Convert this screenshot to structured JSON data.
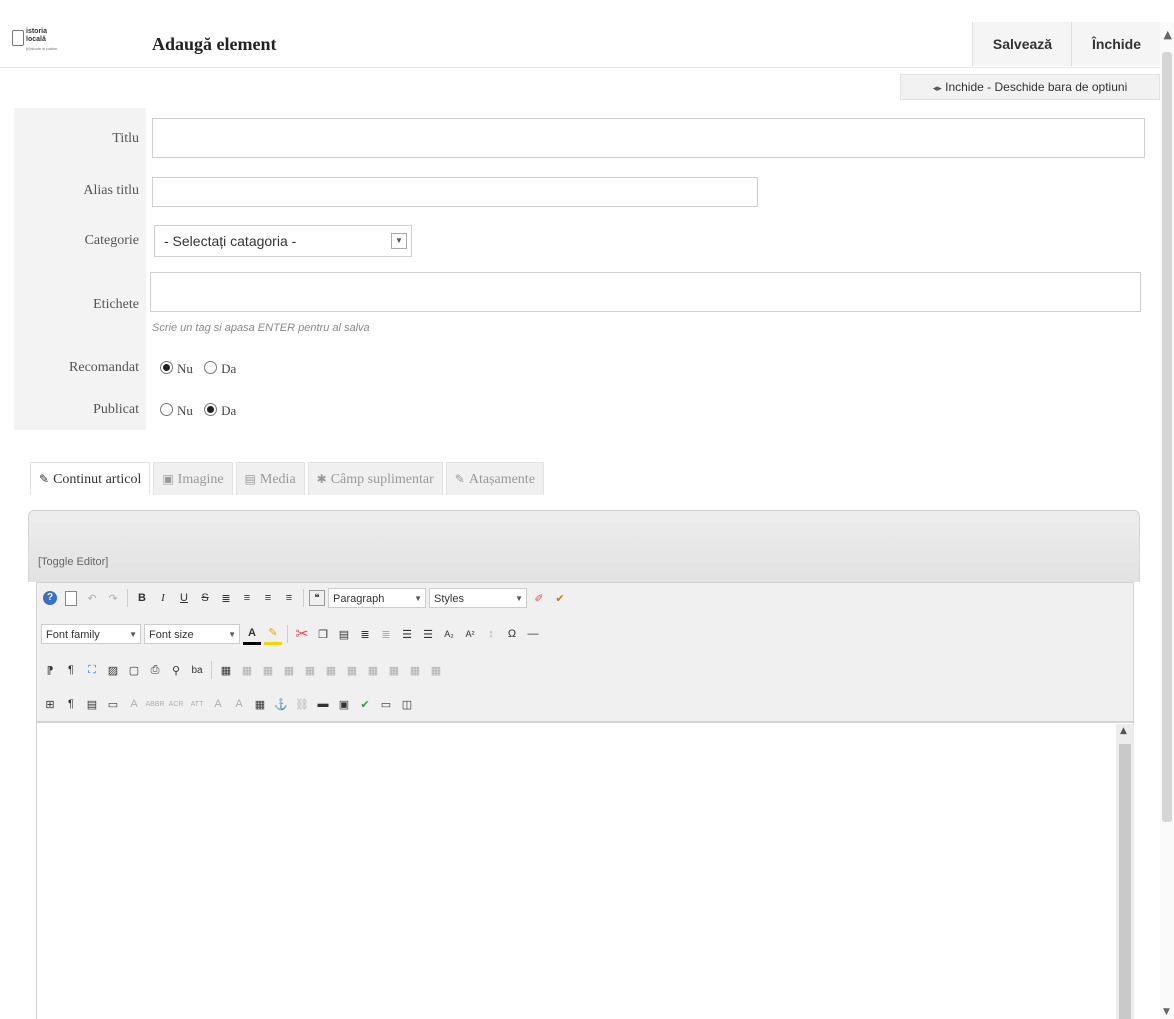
{
  "header": {
    "logo_line1": "istoria",
    "logo_line2": "locală",
    "logo_line3": "(il)istorie și patrim",
    "title": "Adaugă element",
    "save_label": "Salvează",
    "close_label": "Închide"
  },
  "options_toggle": "Inchide - Deschide bara de optiuni",
  "form": {
    "title_label": "Titlu",
    "title_value": "",
    "alias_label": "Alias titlu",
    "alias_value": "",
    "category_label": "Categorie",
    "category_selected": "- Selectați catagoria -",
    "tags_label": "Etichete",
    "tags_hint": "Scrie un tag si apasa ENTER pentru al salva",
    "recommended_label": "Recomandat",
    "recommended_options": [
      "Nu",
      "Da"
    ],
    "recommended_selected": "Nu",
    "published_label": "Publicat",
    "published_options": [
      "Nu",
      "Da"
    ],
    "published_selected": "Da"
  },
  "tabs": [
    {
      "label": "Continut articol",
      "icon": "edit-icon",
      "active": true
    },
    {
      "label": "Imagine",
      "icon": "image-icon",
      "active": false
    },
    {
      "label": "Media",
      "icon": "film-icon",
      "active": false
    },
    {
      "label": "Câmp suplimentar",
      "icon": "puzzle-icon",
      "active": false
    },
    {
      "label": "Atașamente",
      "icon": "paperclip-icon",
      "active": false
    }
  ],
  "editor": {
    "toggle_label": "[Toggle Editor]",
    "format_select": "Paragraph",
    "styles_select": "Styles",
    "font_family_select": "Font family",
    "font_size_select": "Font size"
  }
}
